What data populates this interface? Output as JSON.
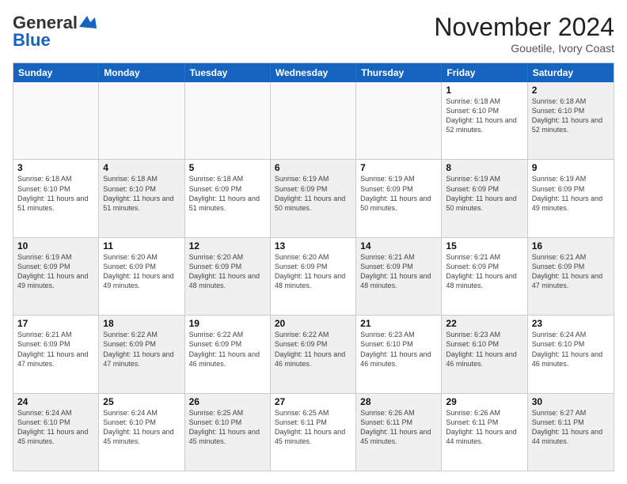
{
  "logo": {
    "line1": "General",
    "line2": "Blue"
  },
  "header": {
    "month": "November 2024",
    "location": "Gouetile, Ivory Coast"
  },
  "weekdays": [
    "Sunday",
    "Monday",
    "Tuesday",
    "Wednesday",
    "Thursday",
    "Friday",
    "Saturday"
  ],
  "rows": [
    [
      {
        "day": "",
        "info": "",
        "empty": true
      },
      {
        "day": "",
        "info": "",
        "empty": true
      },
      {
        "day": "",
        "info": "",
        "empty": true
      },
      {
        "day": "",
        "info": "",
        "empty": true
      },
      {
        "day": "",
        "info": "",
        "empty": true
      },
      {
        "day": "1",
        "info": "Sunrise: 6:18 AM\nSunset: 6:10 PM\nDaylight: 11 hours\nand 52 minutes.",
        "empty": false
      },
      {
        "day": "2",
        "info": "Sunrise: 6:18 AM\nSunset: 6:10 PM\nDaylight: 11 hours\nand 52 minutes.",
        "empty": false,
        "shaded": true
      }
    ],
    [
      {
        "day": "3",
        "info": "Sunrise: 6:18 AM\nSunset: 6:10 PM\nDaylight: 11 hours\nand 51 minutes.",
        "empty": false
      },
      {
        "day": "4",
        "info": "Sunrise: 6:18 AM\nSunset: 6:10 PM\nDaylight: 11 hours\nand 51 minutes.",
        "empty": false,
        "shaded": true
      },
      {
        "day": "5",
        "info": "Sunrise: 6:18 AM\nSunset: 6:09 PM\nDaylight: 11 hours\nand 51 minutes.",
        "empty": false
      },
      {
        "day": "6",
        "info": "Sunrise: 6:19 AM\nSunset: 6:09 PM\nDaylight: 11 hours\nand 50 minutes.",
        "empty": false,
        "shaded": true
      },
      {
        "day": "7",
        "info": "Sunrise: 6:19 AM\nSunset: 6:09 PM\nDaylight: 11 hours\nand 50 minutes.",
        "empty": false
      },
      {
        "day": "8",
        "info": "Sunrise: 6:19 AM\nSunset: 6:09 PM\nDaylight: 11 hours\nand 50 minutes.",
        "empty": false,
        "shaded": true
      },
      {
        "day": "9",
        "info": "Sunrise: 6:19 AM\nSunset: 6:09 PM\nDaylight: 11 hours\nand 49 minutes.",
        "empty": false
      }
    ],
    [
      {
        "day": "10",
        "info": "Sunrise: 6:19 AM\nSunset: 6:09 PM\nDaylight: 11 hours\nand 49 minutes.",
        "empty": false,
        "shaded": true
      },
      {
        "day": "11",
        "info": "Sunrise: 6:20 AM\nSunset: 6:09 PM\nDaylight: 11 hours\nand 49 minutes.",
        "empty": false
      },
      {
        "day": "12",
        "info": "Sunrise: 6:20 AM\nSunset: 6:09 PM\nDaylight: 11 hours\nand 48 minutes.",
        "empty": false,
        "shaded": true
      },
      {
        "day": "13",
        "info": "Sunrise: 6:20 AM\nSunset: 6:09 PM\nDaylight: 11 hours\nand 48 minutes.",
        "empty": false
      },
      {
        "day": "14",
        "info": "Sunrise: 6:21 AM\nSunset: 6:09 PM\nDaylight: 11 hours\nand 48 minutes.",
        "empty": false,
        "shaded": true
      },
      {
        "day": "15",
        "info": "Sunrise: 6:21 AM\nSunset: 6:09 PM\nDaylight: 11 hours\nand 48 minutes.",
        "empty": false
      },
      {
        "day": "16",
        "info": "Sunrise: 6:21 AM\nSunset: 6:09 PM\nDaylight: 11 hours\nand 47 minutes.",
        "empty": false,
        "shaded": true
      }
    ],
    [
      {
        "day": "17",
        "info": "Sunrise: 6:21 AM\nSunset: 6:09 PM\nDaylight: 11 hours\nand 47 minutes.",
        "empty": false
      },
      {
        "day": "18",
        "info": "Sunrise: 6:22 AM\nSunset: 6:09 PM\nDaylight: 11 hours\nand 47 minutes.",
        "empty": false,
        "shaded": true
      },
      {
        "day": "19",
        "info": "Sunrise: 6:22 AM\nSunset: 6:09 PM\nDaylight: 11 hours\nand 46 minutes.",
        "empty": false
      },
      {
        "day": "20",
        "info": "Sunrise: 6:22 AM\nSunset: 6:09 PM\nDaylight: 11 hours\nand 46 minutes.",
        "empty": false,
        "shaded": true
      },
      {
        "day": "21",
        "info": "Sunrise: 6:23 AM\nSunset: 6:10 PM\nDaylight: 11 hours\nand 46 minutes.",
        "empty": false
      },
      {
        "day": "22",
        "info": "Sunrise: 6:23 AM\nSunset: 6:10 PM\nDaylight: 11 hours\nand 46 minutes.",
        "empty": false,
        "shaded": true
      },
      {
        "day": "23",
        "info": "Sunrise: 6:24 AM\nSunset: 6:10 PM\nDaylight: 11 hours\nand 46 minutes.",
        "empty": false
      }
    ],
    [
      {
        "day": "24",
        "info": "Sunrise: 6:24 AM\nSunset: 6:10 PM\nDaylight: 11 hours\nand 45 minutes.",
        "empty": false,
        "shaded": true
      },
      {
        "day": "25",
        "info": "Sunrise: 6:24 AM\nSunset: 6:10 PM\nDaylight: 11 hours\nand 45 minutes.",
        "empty": false
      },
      {
        "day": "26",
        "info": "Sunrise: 6:25 AM\nSunset: 6:10 PM\nDaylight: 11 hours\nand 45 minutes.",
        "empty": false,
        "shaded": true
      },
      {
        "day": "27",
        "info": "Sunrise: 6:25 AM\nSunset: 6:11 PM\nDaylight: 11 hours\nand 45 minutes.",
        "empty": false
      },
      {
        "day": "28",
        "info": "Sunrise: 6:26 AM\nSunset: 6:11 PM\nDaylight: 11 hours\nand 45 minutes.",
        "empty": false,
        "shaded": true
      },
      {
        "day": "29",
        "info": "Sunrise: 6:26 AM\nSunset: 6:11 PM\nDaylight: 11 hours\nand 44 minutes.",
        "empty": false
      },
      {
        "day": "30",
        "info": "Sunrise: 6:27 AM\nSunset: 6:11 PM\nDaylight: 11 hours\nand 44 minutes.",
        "empty": false,
        "shaded": true
      }
    ]
  ]
}
